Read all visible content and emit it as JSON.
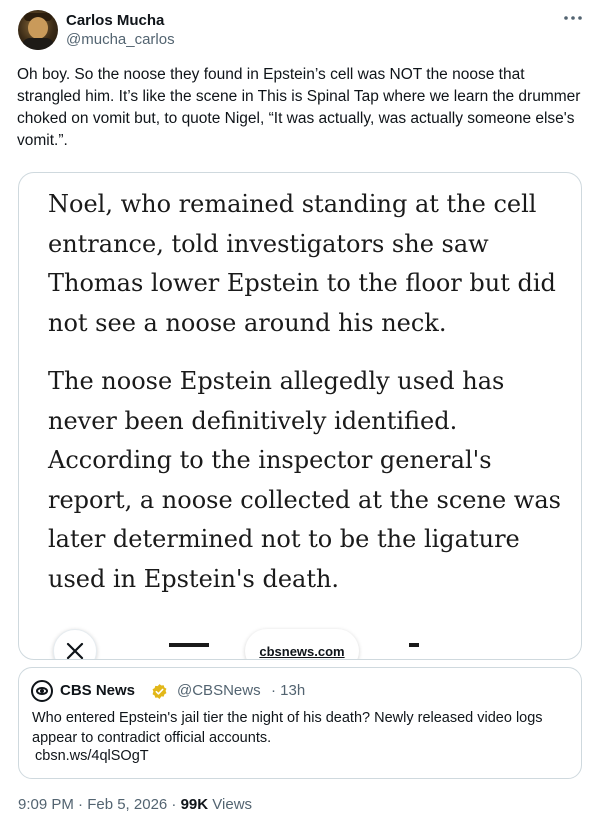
{
  "author": {
    "display_name": "Carlos Mucha",
    "handle": "@mucha_carlos"
  },
  "tweet": {
    "text": "Oh boy. So the noose they found in Epstein’s cell was NOT the noose that strangled him. It’s like the scene in This is Spinal Tap where we learn the drummer choked on vomit but, to quote Nigel, “It was actually, was actually someone else's vomit.”.",
    "more_icon": "more-horizontal-icon"
  },
  "media": {
    "paragraph_1": "Noel, who remained standing at the cell entrance, told investigators she saw Thomas lower Epstein to the floor but did not see a noose around his neck.",
    "paragraph_2": "The noose Epstein allegedly used has never been definitively identified. According to the inspector general's report, a noose collected at the scene was later determined not to be the ligature used in Epstein's death.",
    "source": "cbsnews.com",
    "close_icon": "close-icon"
  },
  "quote": {
    "name": "CBS News",
    "handle": "@CBSNews",
    "time": "· 13h",
    "text": "Who entered Epstein's jail tier the night of his death? Newly released video logs appear to contradict official accounts.",
    "link": "cbsn.ws/4qlSOgT",
    "verified_color": "#e2b719"
  },
  "meta": {
    "datetime": "9:09 PM · Feb 5, 2026 · ",
    "views_count": "99K",
    "views_label": " Views"
  }
}
